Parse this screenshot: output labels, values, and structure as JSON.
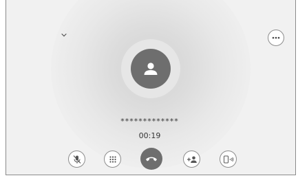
{
  "call": {
    "number_masked": "*************",
    "elapsed_time": "00:19"
  },
  "icons": {
    "collapse": "chevron-down-icon",
    "more": "more-options-icon",
    "contact": "person-icon",
    "mute": "microphone-muted-icon",
    "keypad": "dialpad-icon",
    "end_call": "phone-hang-up-icon",
    "add_call": "add-person-icon",
    "audio_source": "phone-audio-icon"
  },
  "colors": {
    "background": "#f1f1f1",
    "avatar": "#6e6e6e",
    "end_call": "#6e6e6e",
    "button_border": "#8c8c8c",
    "text": "#333333"
  }
}
